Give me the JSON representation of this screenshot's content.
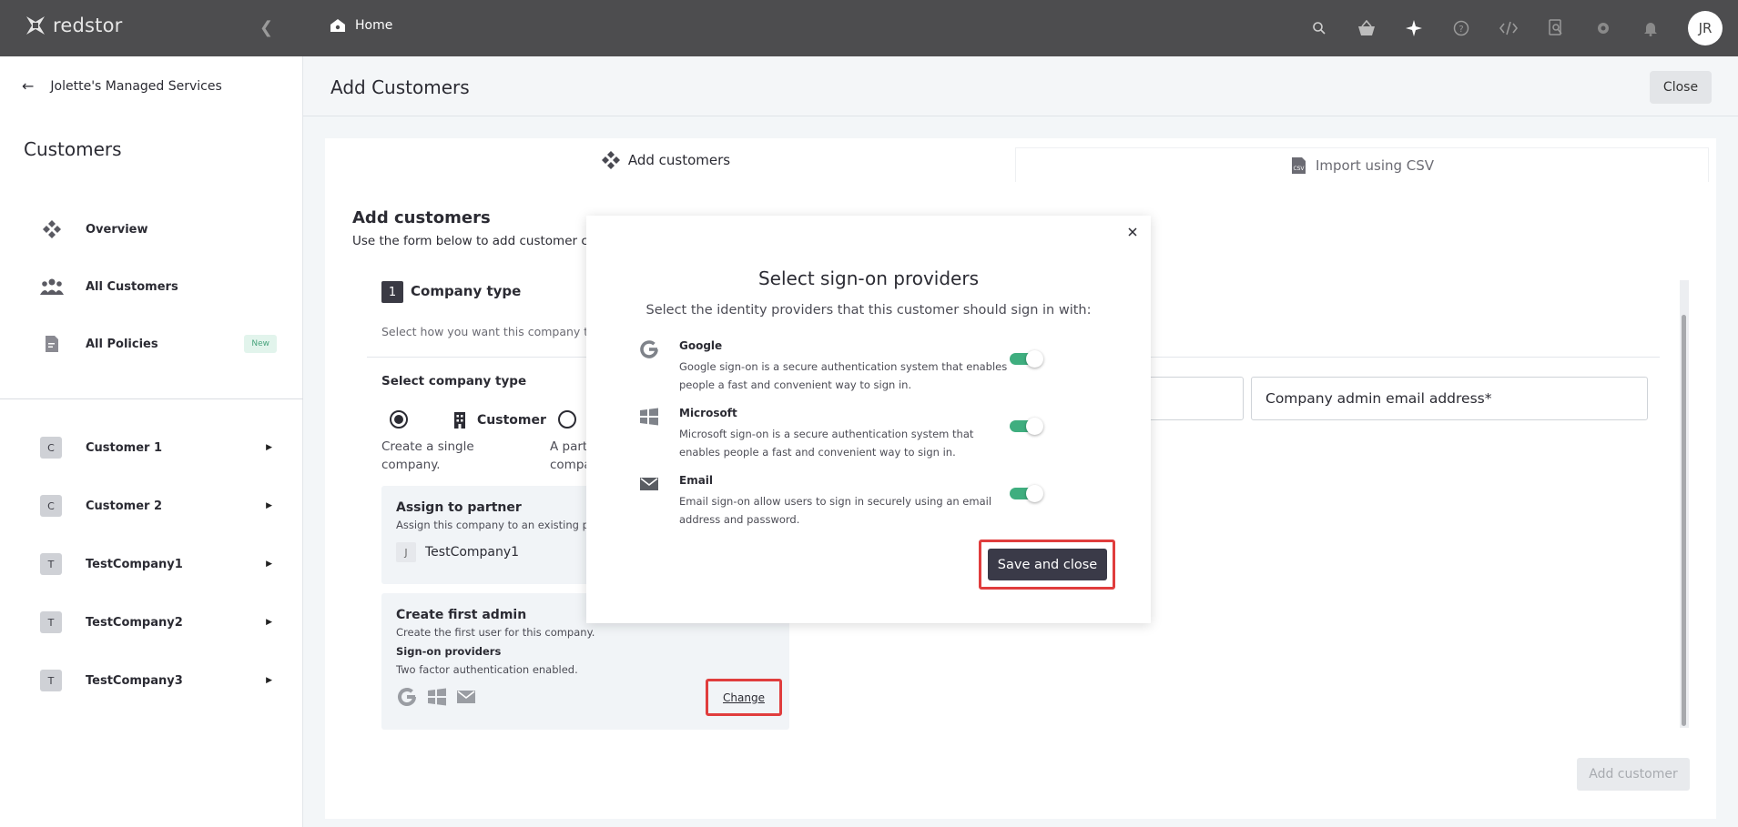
{
  "app": {
    "brand": "redstor",
    "user_initials": "JR"
  },
  "topbar": {
    "breadcrumb": "Home",
    "icons": [
      "search-icon",
      "basket-icon",
      "sparkle-icon",
      "help-icon",
      "code-icon",
      "search-doc-icon",
      "gear-icon",
      "bell-icon"
    ]
  },
  "sidebar": {
    "back_label": "Jolette's Managed Services",
    "section_title": "Customers",
    "nav": [
      {
        "label": "Overview",
        "icon": "overview-icon"
      },
      {
        "label": "All Customers",
        "icon": "people-icon"
      },
      {
        "label": "All Policies",
        "icon": "document-icon",
        "badge": "New"
      }
    ],
    "customers": [
      {
        "letter": "C",
        "name": "Customer 1"
      },
      {
        "letter": "C",
        "name": "Customer 2"
      },
      {
        "letter": "T",
        "name": "TestCompany1"
      },
      {
        "letter": "T",
        "name": "TestCompany2"
      },
      {
        "letter": "T",
        "name": "TestCompany3"
      }
    ]
  },
  "page": {
    "title": "Add Customers",
    "close_label": "Close"
  },
  "tabs": [
    {
      "label": "Add customers",
      "active": true
    },
    {
      "label": "Import using CSV",
      "active": false
    }
  ],
  "form": {
    "title": "Add customers",
    "subtitle": "Use the form below to add customer co",
    "step_number": "1",
    "step_title": "Company type",
    "step_sub": "Select how you want this company to",
    "select_type_label": "Select company type",
    "type_customer": {
      "label": "Customer",
      "desc_line1": "Create a single",
      "desc_line2": "company."
    },
    "type_partner": {
      "desc_line1": "A part",
      "desc_line2": "compa"
    },
    "assign": {
      "title": "Assign to partner",
      "desc": "Assign this company to an existing par",
      "partner_letter": "J",
      "partner_name": "TestCompany1"
    },
    "admin": {
      "title": "Create first admin",
      "desc": "Create the first user for this company.",
      "providers_title": "Sign-on providers",
      "providers_desc": "Two factor authentication enabled.",
      "change_label": "Change"
    },
    "email_field": "Company admin email address*",
    "add_customer_label": "Add customer"
  },
  "modal": {
    "title": "Select sign-on providers",
    "subtitle": "Select the identity providers that this customer should sign in with:",
    "providers": [
      {
        "name": "Google",
        "desc": "Google sign-on is a secure authentication system that enables people a fast and convenient way to sign in.",
        "enabled": true,
        "icon": "google-icon"
      },
      {
        "name": "Microsoft",
        "desc": "Microsoft sign-on is a secure authentication system that enables people a fast and convenient way to sign in.",
        "enabled": true,
        "icon": "windows-icon"
      },
      {
        "name": "Email",
        "desc": "Email sign-on allow users to sign in securely using an email address and password.",
        "enabled": true,
        "icon": "mail-icon"
      }
    ],
    "save_label": "Save and close"
  },
  "colors": {
    "topbar": "#4d4d4f",
    "accent_green": "#3fae7f",
    "highlight_red": "#e03d3d",
    "primary_button": "#3a3a48"
  }
}
